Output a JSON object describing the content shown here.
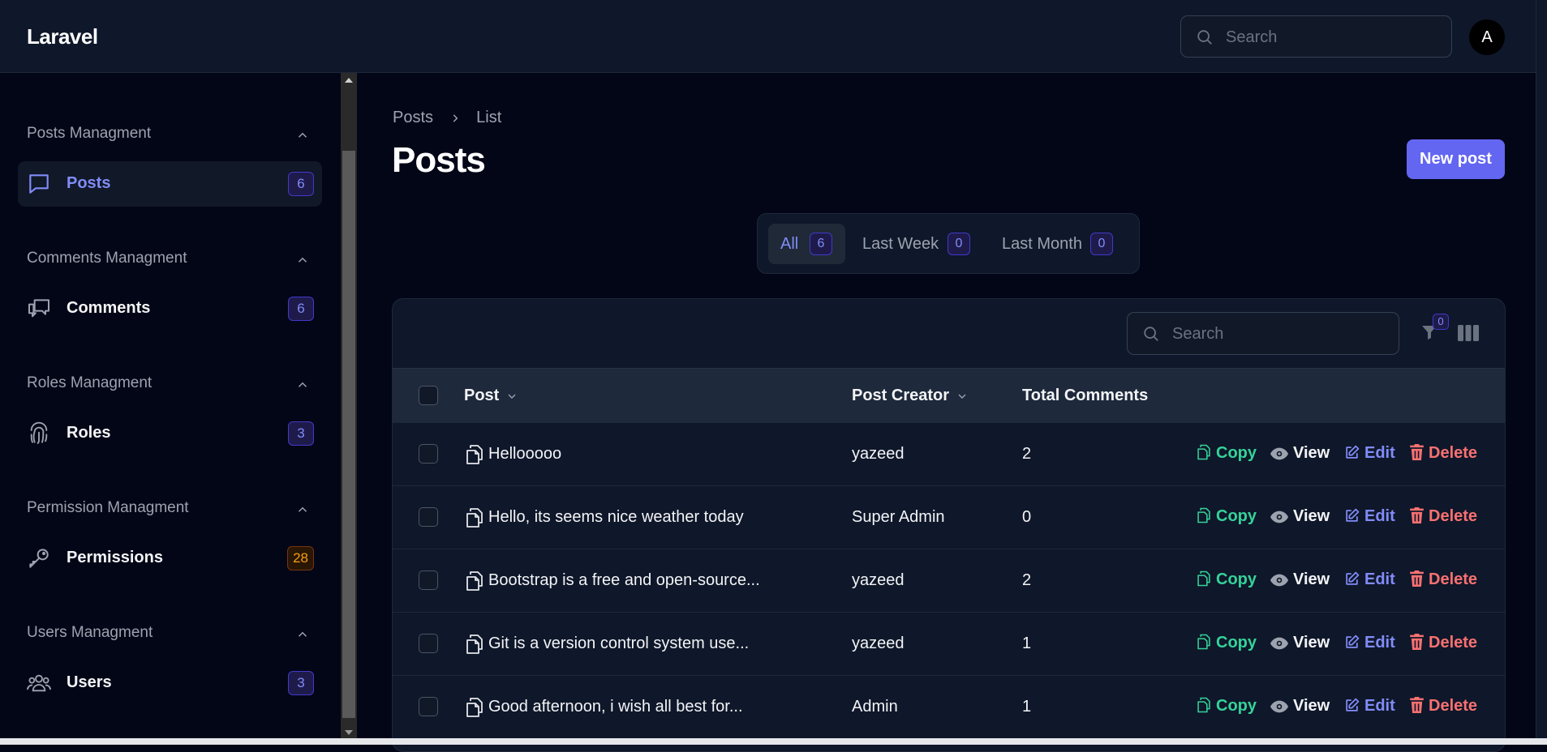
{
  "app": {
    "brand": "Laravel",
    "avatar_initial": "A"
  },
  "topbar": {
    "search_placeholder": "Search"
  },
  "sidebar": {
    "groups": [
      {
        "title": "Posts Managment",
        "item": {
          "label": "Posts",
          "count": "6",
          "icon": "chat-bubble-icon",
          "active": true
        }
      },
      {
        "title": "Comments Managment",
        "item": {
          "label": "Comments",
          "count": "6",
          "icon": "chat-bubbles-icon",
          "active": false
        }
      },
      {
        "title": "Roles Managment",
        "item": {
          "label": "Roles",
          "count": "3",
          "icon": "fingerprint-icon",
          "active": false
        }
      },
      {
        "title": "Permission Managment",
        "item": {
          "label": "Permissions",
          "count": "28",
          "icon": "key-icon",
          "active": false
        }
      },
      {
        "title": "Users Managment",
        "item": {
          "label": "Users",
          "count": "3",
          "icon": "users-icon",
          "active": false
        }
      }
    ]
  },
  "breadcrumb": {
    "parent": "Posts",
    "current": "List"
  },
  "page": {
    "title": "Posts",
    "new_button": "New post"
  },
  "tabs": [
    {
      "label": "All",
      "count": "6",
      "active": true
    },
    {
      "label": "Last Week",
      "count": "0",
      "active": false
    },
    {
      "label": "Last Month",
      "count": "0",
      "active": false
    }
  ],
  "table": {
    "search_placeholder": "Search",
    "filter_count": "0",
    "columns": {
      "post": "Post",
      "creator": "Post Creator",
      "comments": "Total Comments"
    },
    "actions": {
      "copy": "Copy",
      "view": "View",
      "edit": "Edit",
      "delete": "Delete"
    },
    "rows": [
      {
        "post": "Hellooooo",
        "creator": "yazeed",
        "comments": "2"
      },
      {
        "post": "Hello, its seems nice weather today",
        "creator": "Super Admin",
        "comments": "0"
      },
      {
        "post": "Bootstrap is a free and open-source...",
        "creator": "yazeed",
        "comments": "2"
      },
      {
        "post": "Git is a version control system use...",
        "creator": "yazeed",
        "comments": "1"
      },
      {
        "post": "Good afternoon, i wish all best for...",
        "creator": "Admin",
        "comments": "1"
      }
    ]
  },
  "colors": {
    "accent": "#6366f1",
    "copy": "#34d399",
    "edit": "#818cf8",
    "delete": "#f87171",
    "warning_badge": "#f59e0b"
  }
}
